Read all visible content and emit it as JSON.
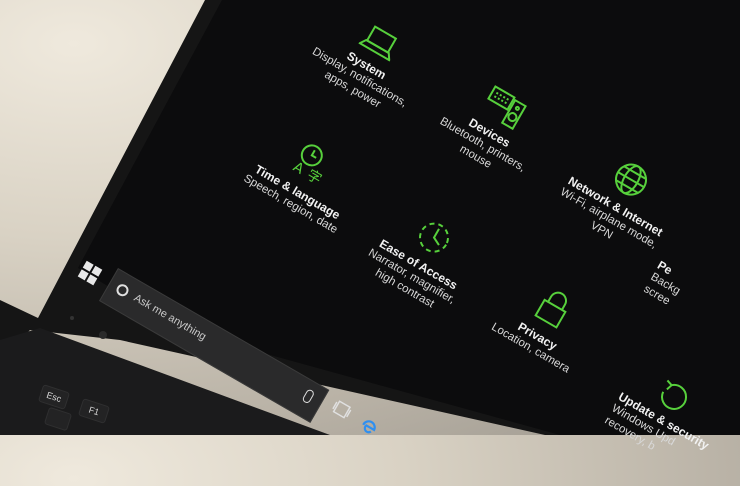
{
  "settings": {
    "system": {
      "title": "System",
      "desc1": "Display, notifications,",
      "desc2": "apps, power"
    },
    "devices": {
      "title": "Devices",
      "desc1": "Bluetooth, printers,",
      "desc2": "mouse"
    },
    "network": {
      "title": "Network & Internet",
      "desc1": "Wi-Fi, airplane mode,",
      "desc2": "VPN"
    },
    "time": {
      "title": "Time & language",
      "desc1": "Speech, region, date",
      "desc2": ""
    },
    "ease": {
      "title": "Ease of Access",
      "desc1": "Narrator, magnifier,",
      "desc2": "high contrast"
    },
    "privacy": {
      "title": "Privacy",
      "desc1": "Location, camera",
      "desc2": ""
    },
    "personalization": {
      "title": "Pe",
      "desc1": "Backg",
      "desc2": "scree"
    },
    "update": {
      "title": "Update & security",
      "desc1": "Windows Upd",
      "desc2": "recovery, b"
    }
  },
  "taskbar": {
    "search_placeholder": "Ask me anything"
  },
  "keyboard": {
    "esc": "Esc",
    "f1": "F1"
  },
  "colors": {
    "accent": "#57d03c",
    "screen_bg": "#0c0c0d",
    "text": "#e6e6e6"
  },
  "icons": {
    "system": "laptop-icon",
    "devices": "keyboard-speaker-icon",
    "network": "globe-icon",
    "time": "clock-language-icon",
    "ease": "ease-of-access-icon",
    "privacy": "lock-icon",
    "update": "refresh-icon",
    "start": "windows-logo-icon",
    "search": "cortana-circle-icon",
    "mic": "microphone-icon",
    "taskview": "task-view-icon",
    "edge": "edge-browser-icon"
  }
}
